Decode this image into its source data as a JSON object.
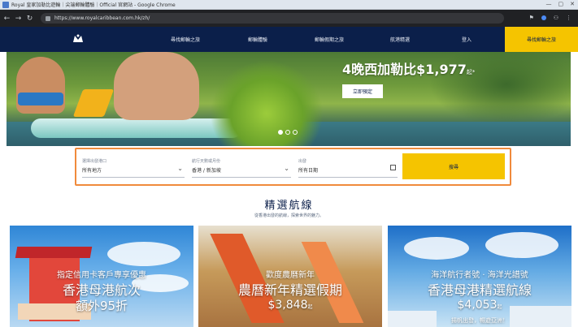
{
  "window": {
    "title": "Royal 皇家加勒比遊輪｜尖端郵輪體驗｜Official 官網站 - Google Chrome",
    "controls": [
      "—",
      "▢",
      "✕"
    ]
  },
  "browser": {
    "url": "https://www.royalcaribbean.com.hk/zh/"
  },
  "nav": {
    "items": [
      "尋找郵輪之旅",
      "郵輪體驗",
      "郵輪假期之旅",
      "航港精選",
      "登入"
    ],
    "book_label": "尋找郵輪之旅"
  },
  "hero": {
    "headline": "4晚西加勒比$1,977",
    "headline_suffix": "起*",
    "cta": "立即預定"
  },
  "search": {
    "destination_label": "選擇出發港口",
    "destination_value": "所有地方",
    "port_label": "航行天數或月份",
    "port_value": "香港 / 新加坡",
    "date_label": "出發",
    "date_value": "所有日期",
    "button": "搜尋"
  },
  "section": {
    "title": "精選航線",
    "subtitle": "從香港出發的航線，探索世界的魅力。"
  },
  "cards": [
    {
      "tag": "指定信用卡客戶專享優惠",
      "title": "香港母港航次",
      "offer": "額外95折"
    },
    {
      "tag": "歡度農曆新年",
      "title": "農曆新年精選假期",
      "price": "$3,848",
      "price_suffix": "起"
    },
    {
      "tag": "海洋航行者號 · 海洋光譜號",
      "title": "香港母港精選航線",
      "price": "$4,053",
      "price_suffix": "起",
      "footer": "揚帆出發，暢遊亞洲！"
    }
  ]
}
